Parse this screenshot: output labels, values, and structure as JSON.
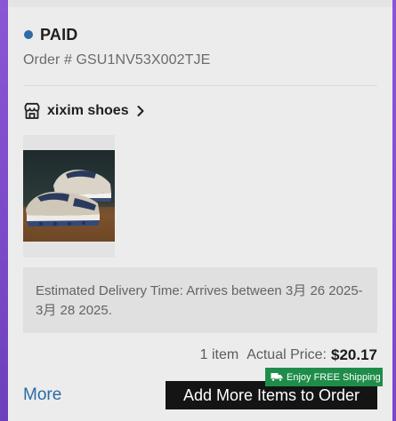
{
  "order": {
    "status": "PAID",
    "order_number": "Order # GSU1NV53X002TJE",
    "status_color": "#2f6ba6"
  },
  "shop": {
    "name": "xixim shoes",
    "icon": "store-icon",
    "chevron_icon": "chevron-right-icon"
  },
  "product": {
    "image_icon": "sneakers-image"
  },
  "delivery": {
    "text": "Estimated Delivery Time: Arrives between 3月 26 2025-3月 28 2025."
  },
  "summary": {
    "item_count": "1 item",
    "price_label": "Actual Price:",
    "price_value": "$20.17"
  },
  "actions": {
    "more_label": "More",
    "add_more_label": "Add More Items to Order",
    "badge_text": "Enjoy FREE Shipping",
    "badge_icon": "truck-icon",
    "badge_color": "#1f8d4a",
    "link_color": "#2c6aa8"
  }
}
